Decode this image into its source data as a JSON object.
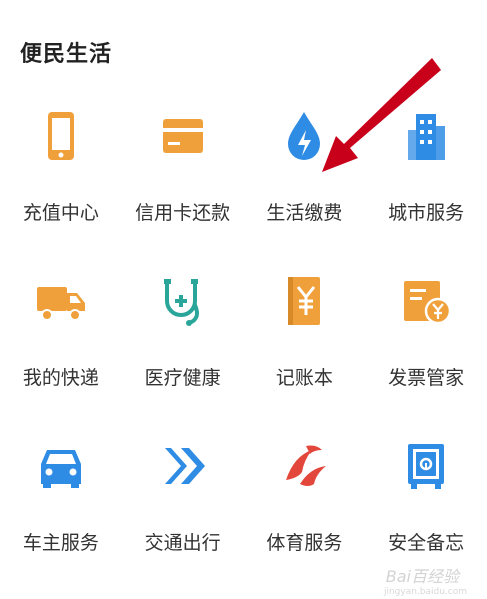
{
  "section": {
    "title": "便民生活"
  },
  "colors": {
    "orange": "#F0A03A",
    "blue": "#2F8CE5",
    "teal": "#29A59A",
    "red": "#E3473B",
    "arrow": "#C8001A"
  },
  "items": [
    {
      "label": "充值中心",
      "icon": "phone-icon"
    },
    {
      "label": "信用卡还款",
      "icon": "credit-card-icon"
    },
    {
      "label": "生活缴费",
      "icon": "utility-drop-bolt-icon"
    },
    {
      "label": "城市服务",
      "icon": "city-building-icon"
    },
    {
      "label": "我的快递",
      "icon": "delivery-truck-icon"
    },
    {
      "label": "医疗健康",
      "icon": "medical-stethoscope-icon"
    },
    {
      "label": "记账本",
      "icon": "ledger-book-yuan-icon"
    },
    {
      "label": "发票管家",
      "icon": "invoice-yuan-icon"
    },
    {
      "label": "车主服务",
      "icon": "car-icon"
    },
    {
      "label": "交通出行",
      "icon": "transport-chevrons-icon"
    },
    {
      "label": "体育服务",
      "icon": "sports-emblem-icon"
    },
    {
      "label": "安全备忘",
      "icon": "safe-box-icon"
    }
  ],
  "watermark": {
    "text": "Bai百经验",
    "sub": "jingyan.baidu.com"
  }
}
